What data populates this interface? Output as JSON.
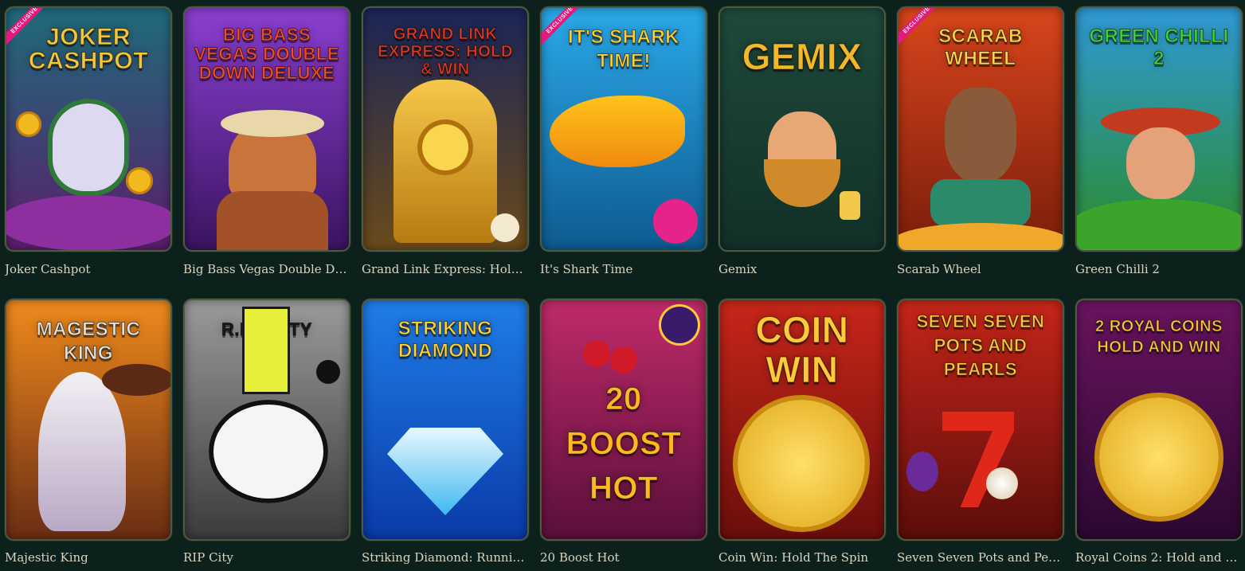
{
  "games": [
    {
      "name": "Joker Cashpot",
      "art_title": "Joker Cashpot",
      "badge": "EXCLUSIVE",
      "bg": [
        "#1f6b7a",
        "#5a1e6b"
      ],
      "title_color": "#f4c63a"
    },
    {
      "name": "Big Bass Vegas Double Dow...",
      "art_title": "Big Bass Vegas Double Down Deluxe",
      "badge": "",
      "bg": [
        "#8b3fd1",
        "#3a1460"
      ],
      "title_color": "#f24c2c"
    },
    {
      "name": "Grand Link Express: Hold &...",
      "art_title": "Grand Link Express: Hold & Win",
      "badge": "",
      "bg": [
        "#1b2558",
        "#6a4b1a"
      ],
      "title_color": "#e23b22"
    },
    {
      "name": "It's Shark Time",
      "art_title": "It's Shark Time!",
      "badge": "EXCLUSIVE",
      "bg": [
        "#2aa9e8",
        "#0e5a8f"
      ],
      "title_color": "#ffd23a"
    },
    {
      "name": "Gemix",
      "art_title": "Gemix",
      "badge": "",
      "bg": [
        "#1e4a3a",
        "#123028"
      ],
      "title_color": "#f3b82a"
    },
    {
      "name": "Scarab Wheel",
      "art_title": "Scarab Wheel",
      "badge": "EXCLUSIVE",
      "bg": [
        "#d9451c",
        "#7a1d0b"
      ],
      "title_color": "#ffd54a"
    },
    {
      "name": "Green Chilli 2",
      "art_title": "Green Chilli 2",
      "badge": "",
      "bg": [
        "#2f9ad6",
        "#2b8a2b"
      ],
      "title_color": "#3fd23a"
    },
    {
      "name": "Majestic King",
      "art_title": "Magestic King",
      "badge": "",
      "bg": [
        "#f08a1c",
        "#6a2d14"
      ],
      "title_color": "#e8e4dc"
    },
    {
      "name": "RIP City",
      "art_title": "R.I.P. City",
      "badge": "",
      "bg": [
        "#9a9a9a",
        "#3b3b3b"
      ],
      "title_color": "#e6f03a"
    },
    {
      "name": "Striking Diamond: Running ...",
      "art_title": "Striking Diamond",
      "badge": "",
      "bg": [
        "#1f7ee8",
        "#0a3aa8"
      ],
      "title_color": "#ffd23a"
    },
    {
      "name": "20 Boost Hot",
      "art_title": "20 Boost Hot",
      "badge": "",
      "bg": [
        "#c02a6a",
        "#5a0f3a"
      ],
      "title_color": "#ffb81e"
    },
    {
      "name": "Coin Win: Hold The Spin",
      "art_title": "Coin Win",
      "badge": "",
      "bg": [
        "#c8261a",
        "#6a0e0a"
      ],
      "title_color": "#ffc93a"
    },
    {
      "name": "Seven Seven Pots and Pearls",
      "art_title": "Seven Seven Pots and Pearls",
      "badge": "",
      "bg": [
        "#c8261a",
        "#5a0d0a"
      ],
      "title_color": "#ffc93a"
    },
    {
      "name": "Royal Coins 2: Hold and Win",
      "art_title": "2 Royal Coins Hold and Win",
      "badge": "",
      "bg": [
        "#6a1460",
        "#2b0830"
      ],
      "title_color": "#ffc93a"
    }
  ]
}
